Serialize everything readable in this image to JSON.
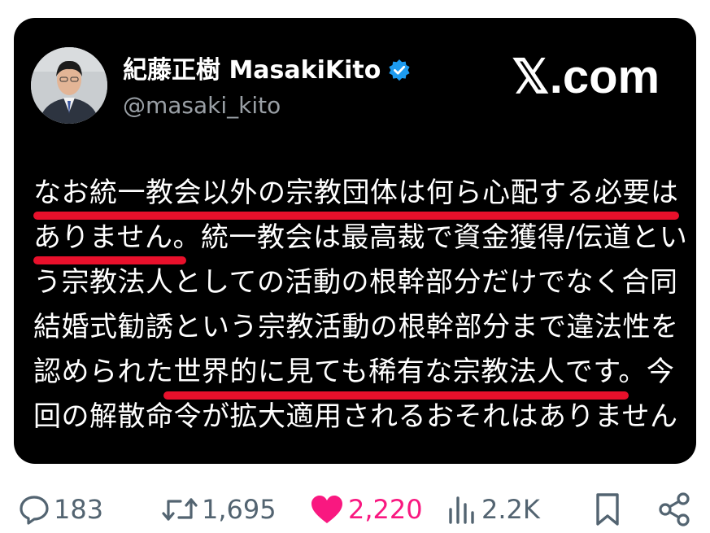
{
  "post": {
    "author": {
      "display_name": "紀藤正樹 MasakiKito",
      "handle": "@masaki_kito",
      "verified": true
    },
    "brand": "𝕏.com",
    "text_lines": [
      "なお統一教会以外の宗教団体は何ら心配する必要は",
      "ありません。統一教会は最高裁で資金獲得/伝道とい",
      "う宗教法人としての活動の根幹部分だけでなく合同",
      "結婚式勧誘という宗教活動の根幹部分まで違法性を",
      "認められた世界的に見ても稀有な宗教法人です。今",
      "回の解散命令が拡大適用されるおそれはありません"
    ],
    "highlight_color": "#e8102b"
  },
  "actions": {
    "replies": "183",
    "reposts": "1,695",
    "likes": "2,220",
    "views": "2.2K",
    "reply_icon": "reply-icon",
    "repost_icon": "repost-icon",
    "like_icon": "heart-icon",
    "views_icon": "views-icon",
    "bookmark_icon": "bookmark-icon",
    "share_icon": "share-icon",
    "like_color": "#f91880",
    "icon_color": "#536471"
  }
}
